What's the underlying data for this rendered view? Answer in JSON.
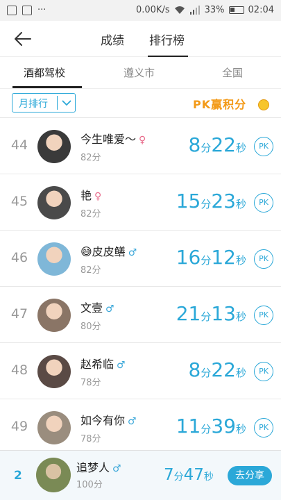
{
  "statusbar": {
    "dots": "···",
    "network_speed": "0.00K/s",
    "battery_pct": "33%",
    "clock": "02:04"
  },
  "header": {
    "tabs": [
      "成绩",
      "排行榜"
    ],
    "active_tab_index": 1
  },
  "subtabs": {
    "items": [
      "酒都驾校",
      "遵义市",
      "全国"
    ],
    "active_index": 0
  },
  "filter": {
    "period_selected": "月排行",
    "pk_banner": "PK赢积分"
  },
  "rows": [
    {
      "rank": "44",
      "name": "今生唯爱～",
      "gender": "♀",
      "gender_type": "female",
      "score": "82分",
      "min": "8",
      "min_unit": "分",
      "sec": "22",
      "sec_unit": "秒",
      "pk": "PK",
      "avatar_color": "#3a3a3a"
    },
    {
      "rank": "45",
      "name": "艳",
      "gender": "♀",
      "gender_type": "female",
      "score": "82分",
      "min": "15",
      "min_unit": "分",
      "sec": "23",
      "sec_unit": "秒",
      "pk": "PK",
      "avatar_color": "#4a4a4a"
    },
    {
      "rank": "46",
      "name": "😅皮皮鳝",
      "gender": "♂",
      "gender_type": "male",
      "score": "82分",
      "min": "16",
      "min_unit": "分",
      "sec": "12",
      "sec_unit": "秒",
      "pk": "PK",
      "avatar_color": "#7fb7d8"
    },
    {
      "rank": "47",
      "name": "文壹",
      "gender": "♂",
      "gender_type": "male",
      "score": "80分",
      "min": "21",
      "min_unit": "分",
      "sec": "13",
      "sec_unit": "秒",
      "pk": "PK",
      "avatar_color": "#8a7566"
    },
    {
      "rank": "48",
      "name": "赵希临",
      "gender": "♂",
      "gender_type": "male",
      "score": "78分",
      "min": "8",
      "min_unit": "分",
      "sec": "22",
      "sec_unit": "秒",
      "pk": "PK",
      "avatar_color": "#5a4a45"
    },
    {
      "rank": "49",
      "name": "如今有你",
      "gender": "♂",
      "gender_type": "male",
      "score": "78分",
      "min": "11",
      "min_unit": "分",
      "sec": "39",
      "sec_unit": "秒",
      "pk": "PK",
      "avatar_color": "#9a8d7e"
    }
  ],
  "me": {
    "rank": "2",
    "name": "追梦人",
    "gender": "♂",
    "score": "100分",
    "min": "7",
    "min_unit": "分",
    "sec": "47",
    "sec_unit": "秒",
    "share_label": "去分享",
    "avatar_color": "#7a8a55"
  },
  "colors": {
    "accent": "#2ba8d8",
    "male": "#3aa7d9",
    "female": "#e86a8a",
    "pk_orange": "#f39a18"
  }
}
